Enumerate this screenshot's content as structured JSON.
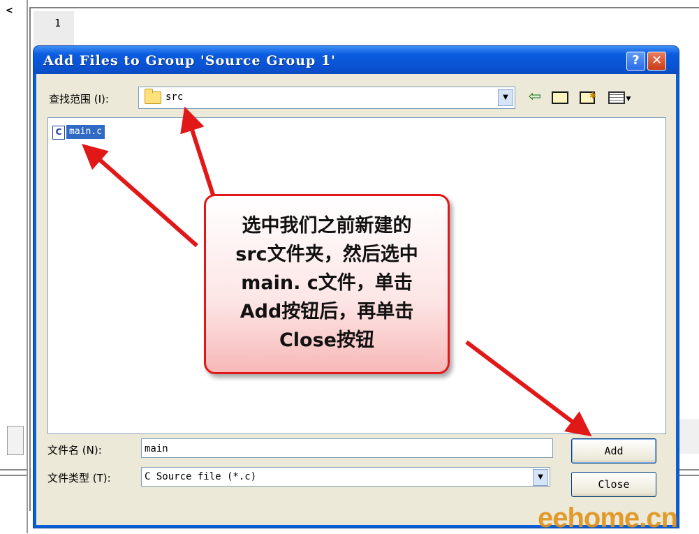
{
  "background_ide": {
    "line_number": "1",
    "left_arrow": "<"
  },
  "dialog": {
    "title": "Add Files to Group 'Source Group 1'",
    "help_button": "?",
    "close_button": "✕",
    "look_in_label": "查找范围 (I):",
    "look_in_value": "src",
    "combo_arrow": "▼",
    "files": [
      {
        "icon": "C",
        "name": "main.c",
        "selected": true
      }
    ],
    "file_name_label": "文件名 (N):",
    "file_name_value": "main",
    "file_type_label": "文件类型 (T):",
    "file_type_value": "C Source file (*.c)",
    "add_label": "Add",
    "close_label": "Close"
  },
  "annotation": {
    "lines": [
      "选中我们之前新建的",
      "src文件夹，然后选中",
      "main. c文件，单击",
      "Add按钮后，再单击",
      "Close按钮"
    ]
  },
  "watermark": "eehome.cn",
  "colors": {
    "title_bar": "#0a53d4",
    "dialog_face": "#ece9d8",
    "selection": "#316ac5",
    "callout_border": "#e01818",
    "arrow": "#e01818",
    "watermark": "#e0921a"
  }
}
